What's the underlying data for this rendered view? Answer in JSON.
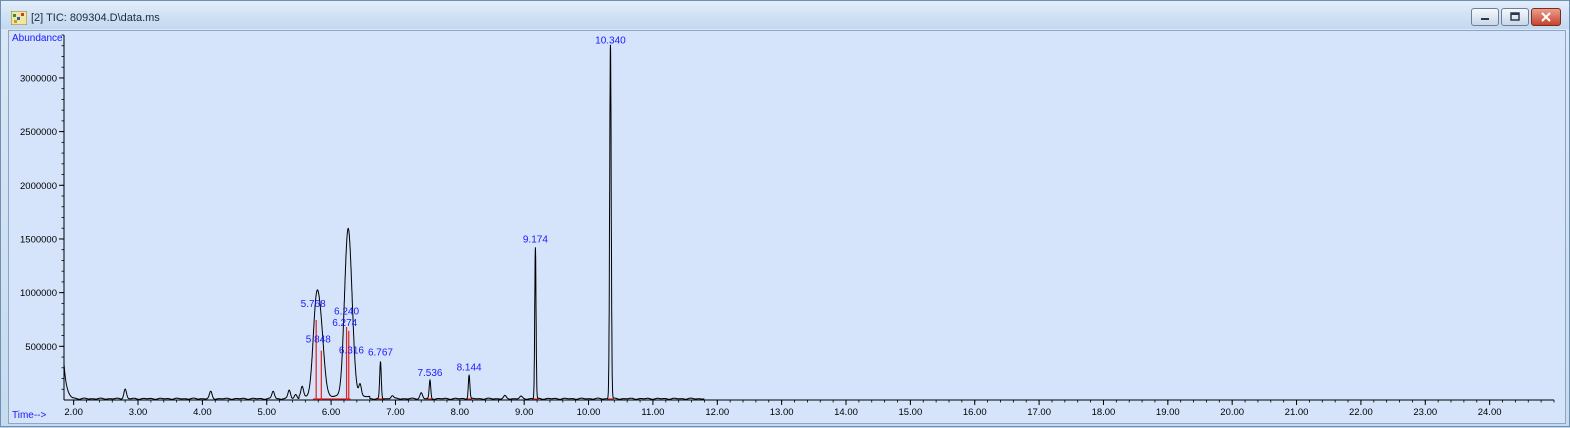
{
  "window": {
    "title": "[2] TIC: 809304.D\\data.ms",
    "icon": "chromatogram-app-icon",
    "buttons": {
      "minimize": "minimize-icon",
      "maximize": "maximize-icon",
      "close": "close-icon"
    }
  },
  "chart_data": {
    "type": "line",
    "ylabel": "Abundance",
    "xlabel": "Time-->",
    "xlim": [
      1.85,
      25.0
    ],
    "ylim": [
      0,
      3400000
    ],
    "x_ticks": [
      "2.00",
      "3.00",
      "4.00",
      "5.00",
      "6.00",
      "7.00",
      "8.00",
      "9.00",
      "10.00",
      "11.00",
      "12.00",
      "13.00",
      "14.00",
      "15.00",
      "16.00",
      "17.00",
      "18.00",
      "19.00",
      "20.00",
      "21.00",
      "22.00",
      "23.00",
      "24.00"
    ],
    "y_ticks": [
      "500000",
      "1000000",
      "1500000",
      "2000000",
      "2500000",
      "3000000"
    ],
    "peaks": [
      {
        "label": "5.768",
        "rt": 5.768,
        "height": 810000
      },
      {
        "label": "5.848",
        "rt": 5.848,
        "height": 500000
      },
      {
        "label": "6.240",
        "rt": 6.24,
        "height": 740000
      },
      {
        "label": "6.274",
        "rt": 6.274,
        "height": 710000
      },
      {
        "label": "6.316",
        "rt": 6.316,
        "height": 360000
      },
      {
        "label": "6.767",
        "rt": 6.767,
        "height": 340000
      },
      {
        "label": "7.536",
        "rt": 7.536,
        "height": 170000
      },
      {
        "label": "8.144",
        "rt": 8.144,
        "height": 220000
      },
      {
        "label": "9.174",
        "rt": 9.174,
        "height": 1410000
      },
      {
        "label": "10.340",
        "rt": 10.34,
        "height": 3300000
      }
    ],
    "minor_peaks": [
      {
        "rt": 2.8,
        "height": 90000
      },
      {
        "rt": 4.13,
        "height": 65000
      },
      {
        "rt": 5.1,
        "height": 70000
      },
      {
        "rt": 5.35,
        "height": 80000
      },
      {
        "rt": 5.45,
        "height": 40000
      },
      {
        "rt": 5.55,
        "height": 90000
      },
      {
        "rt": 6.45,
        "height": 110000
      },
      {
        "rt": 6.95,
        "height": 30000
      },
      {
        "rt": 7.4,
        "height": 55000
      },
      {
        "rt": 8.7,
        "height": 25000
      },
      {
        "rt": 8.95,
        "height": 20000
      }
    ],
    "colors": {
      "trace": "#000000",
      "label": "#1a1aff",
      "integration": "#e02020",
      "background": "#d5e4fb"
    }
  }
}
